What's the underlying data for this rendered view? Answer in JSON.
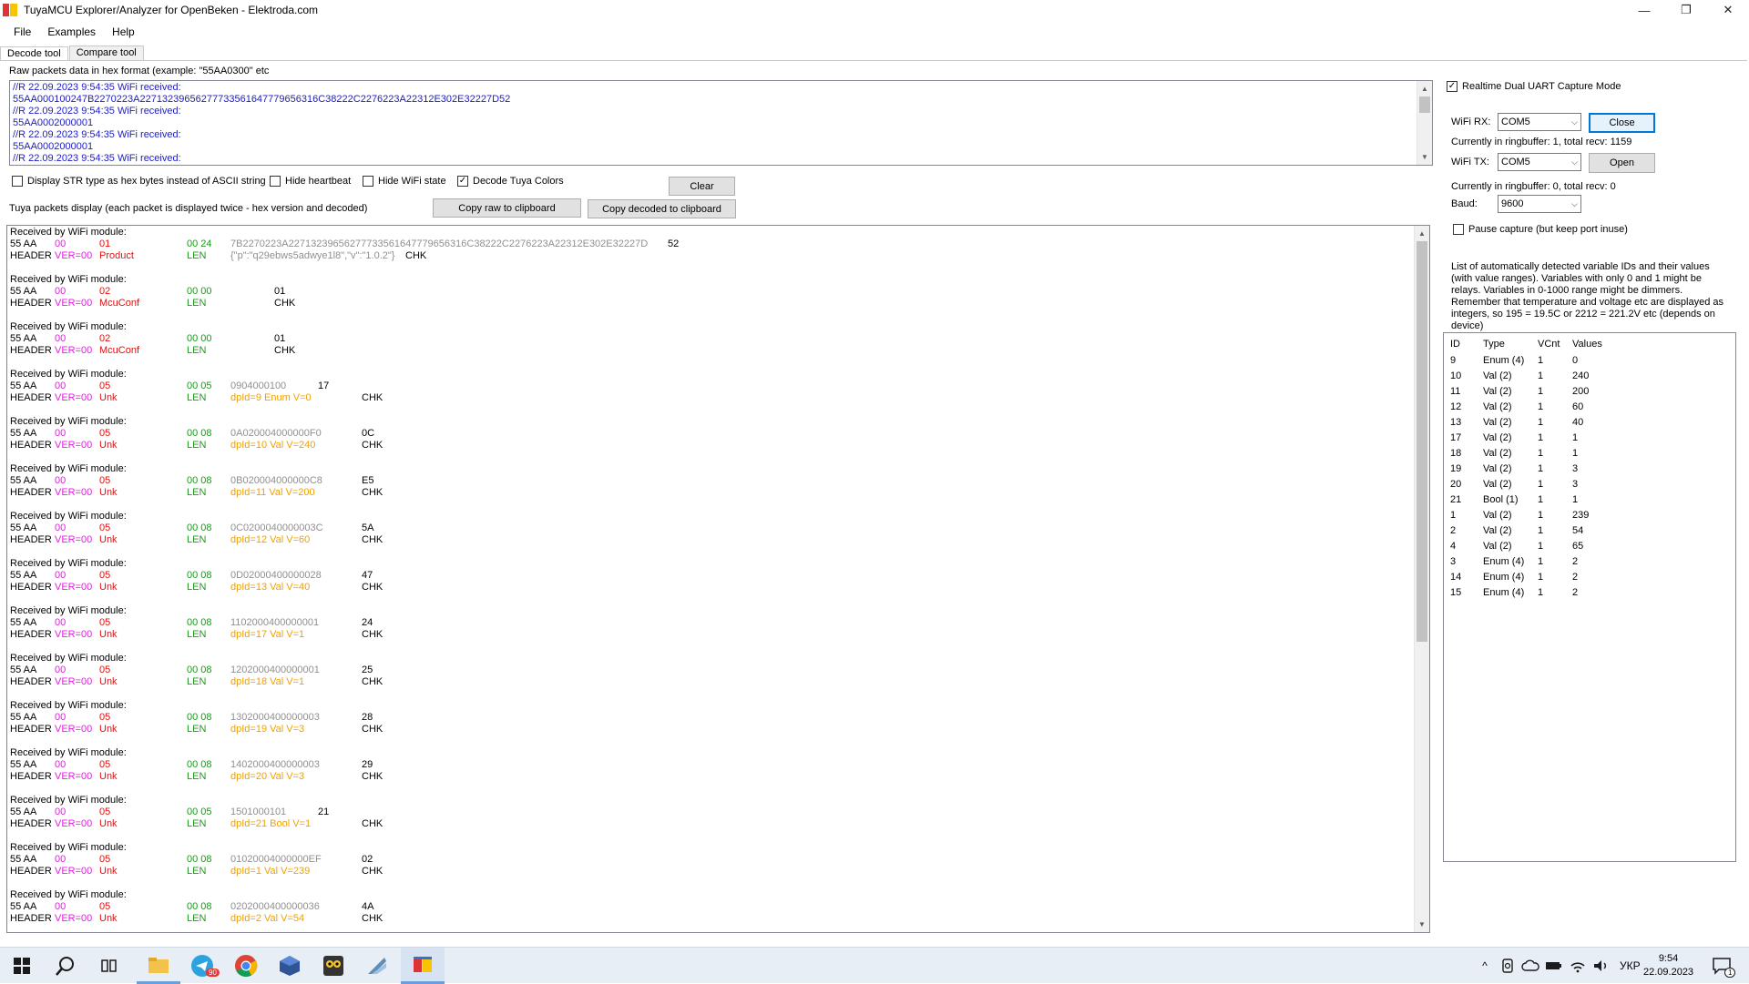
{
  "window": {
    "title": "TuyaMCU Explorer/Analyzer for OpenBeken - Elektroda.com",
    "minimize": "—",
    "maximize": "❐",
    "close": "✕"
  },
  "menu": [
    {
      "label": "File"
    },
    {
      "label": "Examples"
    },
    {
      "label": "Help"
    }
  ],
  "tabs": [
    {
      "label": "Decode tool",
      "active": true
    },
    {
      "label": "Compare tool",
      "active": false
    }
  ],
  "raw": {
    "label": "Raw packets data in hex format (example: \"55AA0300\" etc",
    "lines": [
      "//R 22.09.2023 9:54:35 WiFi received:",
      "55AA000100247B2270223A22713239656277733561647779656316C38222C2276223A22312E302E32227D52",
      "//R 22.09.2023 9:54:35 WiFi received:",
      "55AA0002000001",
      "//R 22.09.2023 9:54:35 WiFi received:",
      "55AA0002000001",
      "//R 22.09.2023 9:54:35 WiFi received:"
    ]
  },
  "options": {
    "display_str": {
      "label": "Display STR type as hex bytes instead of ASCII string",
      "checked": false
    },
    "hide_heartbeat": {
      "label": "Hide heartbeat",
      "checked": false
    },
    "hide_wifi": {
      "label": "Hide WiFi state",
      "checked": false
    },
    "decode_colors": {
      "label": "Decode Tuya Colors",
      "checked": true
    },
    "check_mark": "✓"
  },
  "buttons": {
    "clear": "Clear",
    "copy_raw": "Copy raw to clipboard",
    "copy_decoded": "Copy decoded to clipboard"
  },
  "decoded": {
    "label": "Tuya packets display (each packet is displayed twice - hex version and decoded)",
    "recv": "Received by WiFi module:",
    "hdr": "55 AA",
    "header": "HEADER",
    "len": "LEN",
    "chk": "CHK",
    "packets": [
      {
        "ver": "00",
        "vern": "VER=00",
        "cmd": "01",
        "cmdn": "Product",
        "len": "00 24",
        "pay": "7B2270223A22713239656277733561647779656316C38222C2276223A22312E302E32227D",
        "dec": "{\"p\":\"q29ebws5adwye1l8\",\"v\":\"1.0.2\"}",
        "chk": "52",
        "mode": "product"
      },
      {
        "ver": "00",
        "vern": "VER=00",
        "cmd": "02",
        "cmdn": "McuConf",
        "len": "00 00",
        "pay": "",
        "dec": "",
        "chk": "01",
        "mode": "conf"
      },
      {
        "ver": "00",
        "vern": "VER=00",
        "cmd": "02",
        "cmdn": "McuConf",
        "len": "00 00",
        "pay": "",
        "dec": "",
        "chk": "01",
        "mode": "conf"
      },
      {
        "ver": "00",
        "vern": "VER=00",
        "cmd": "05",
        "cmdn": "Unk",
        "len": "00 05",
        "pay": "0904000100",
        "dec": "dpId=9 Enum V=0",
        "chk": "17",
        "mode": "short"
      },
      {
        "ver": "00",
        "vern": "VER=00",
        "cmd": "05",
        "cmdn": "Unk",
        "len": "00 08",
        "pay": "0A020004000000F0",
        "dec": "dpId=10 Val V=240",
        "chk": "0C",
        "mode": "val"
      },
      {
        "ver": "00",
        "vern": "VER=00",
        "cmd": "05",
        "cmdn": "Unk",
        "len": "00 08",
        "pay": "0B020004000000C8",
        "dec": "dpId=11 Val V=200",
        "chk": "E5",
        "mode": "val"
      },
      {
        "ver": "00",
        "vern": "VER=00",
        "cmd": "05",
        "cmdn": "Unk",
        "len": "00 08",
        "pay": "0C0200040000003C",
        "dec": "dpId=12 Val V=60",
        "chk": "5A",
        "mode": "val"
      },
      {
        "ver": "00",
        "vern": "VER=00",
        "cmd": "05",
        "cmdn": "Unk",
        "len": "00 08",
        "pay": "0D02000400000028",
        "dec": "dpId=13 Val V=40",
        "chk": "47",
        "mode": "val"
      },
      {
        "ver": "00",
        "vern": "VER=00",
        "cmd": "05",
        "cmdn": "Unk",
        "len": "00 08",
        "pay": "1102000400000001",
        "dec": "dpId=17 Val V=1",
        "chk": "24",
        "mode": "val"
      },
      {
        "ver": "00",
        "vern": "VER=00",
        "cmd": "05",
        "cmdn": "Unk",
        "len": "00 08",
        "pay": "1202000400000001",
        "dec": "dpId=18 Val V=1",
        "chk": "25",
        "mode": "val"
      },
      {
        "ver": "00",
        "vern": "VER=00",
        "cmd": "05",
        "cmdn": "Unk",
        "len": "00 08",
        "pay": "1302000400000003",
        "dec": "dpId=19 Val V=3",
        "chk": "28",
        "mode": "val"
      },
      {
        "ver": "00",
        "vern": "VER=00",
        "cmd": "05",
        "cmdn": "Unk",
        "len": "00 08",
        "pay": "1402000400000003",
        "dec": "dpId=20 Val V=3",
        "chk": "29",
        "mode": "val"
      },
      {
        "ver": "00",
        "vern": "VER=00",
        "cmd": "05",
        "cmdn": "Unk",
        "len": "00 05",
        "pay": "1501000101",
        "dec": "dpId=21 Bool V=1",
        "chk": "21",
        "mode": "short"
      },
      {
        "ver": "00",
        "vern": "VER=00",
        "cmd": "05",
        "cmdn": "Unk",
        "len": "00 08",
        "pay": "01020004000000EF",
        "dec": "dpId=1 Val V=239",
        "chk": "02",
        "mode": "val"
      },
      {
        "ver": "00",
        "vern": "VER=00",
        "cmd": "05",
        "cmdn": "Unk",
        "len": "00 08",
        "pay": "0202000400000036",
        "dec": "dpId=2 Val V=54",
        "chk": "4A",
        "mode": "val"
      }
    ]
  },
  "capture": {
    "realtime": {
      "label": "Realtime Dual UART Capture Mode",
      "checked": true
    },
    "wifi_rx": {
      "label": "WiFi RX:",
      "value": "COM5",
      "button": "Close"
    },
    "rx_info": "Currently in ringbuffer: 1, total recv: 1159",
    "wifi_tx": {
      "label": "WiFi TX:",
      "value": "COM5",
      "button": "Open"
    },
    "tx_info": "Currently in ringbuffer: 0, total recv: 0",
    "baud": {
      "label": "Baud:",
      "value": "9600"
    },
    "pause": {
      "label": "Pause capture (but keep port inuse)",
      "checked": false
    }
  },
  "vars": {
    "info": "List of automatically detected variable IDs and their values (with value ranges). Variables with only 0 and 1 might be relays. Variables in 0-1000 range might be dimmers. Remember that temperature and voltage etc are displayed as integers, so 195 = 19.5C or 2212 = 221.2V etc (depends on device)",
    "headers": [
      "ID",
      "Type",
      "VCnt",
      "Values"
    ],
    "rows": [
      [
        "9",
        "Enum (4)",
        "1",
        "0"
      ],
      [
        "10",
        "Val (2)",
        "1",
        "240"
      ],
      [
        "11",
        "Val (2)",
        "1",
        "200"
      ],
      [
        "12",
        "Val (2)",
        "1",
        "60"
      ],
      [
        "13",
        "Val (2)",
        "1",
        "40"
      ],
      [
        "17",
        "Val (2)",
        "1",
        "1"
      ],
      [
        "18",
        "Val (2)",
        "1",
        "1"
      ],
      [
        "19",
        "Val (2)",
        "1",
        "3"
      ],
      [
        "20",
        "Val (2)",
        "1",
        "3"
      ],
      [
        "21",
        "Bool (1)",
        "1",
        "1"
      ],
      [
        "1",
        "Val (2)",
        "1",
        "239"
      ],
      [
        "2",
        "Val (2)",
        "1",
        "54"
      ],
      [
        "4",
        "Val (2)",
        "1",
        "65"
      ],
      [
        "3",
        "Enum (4)",
        "1",
        "2"
      ],
      [
        "14",
        "Enum (4)",
        "1",
        "2"
      ],
      [
        "15",
        "Enum (4)",
        "1",
        "2"
      ]
    ]
  },
  "taskbar": {
    "lang": "УКР",
    "time": "9:54",
    "date": "22.09.2023",
    "telegram_badge": "90",
    "notif_badge": "1",
    "tray_up": "^"
  },
  "colors": {
    "raw_text": "#1d1dc0",
    "ver": "#e020e0",
    "cmd": "#e01010",
    "len": "#1a9a1a",
    "payload": "#909090",
    "decoded": "#f0a000"
  }
}
